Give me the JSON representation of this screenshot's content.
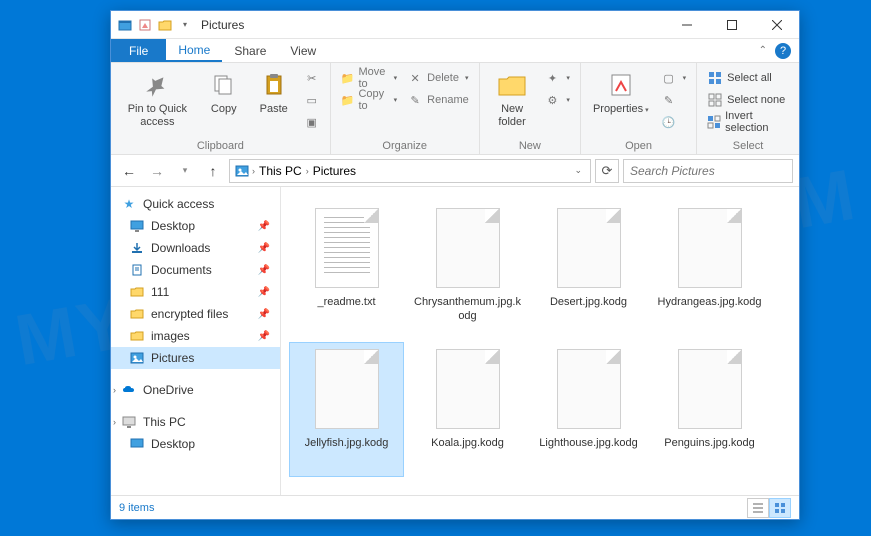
{
  "window": {
    "title": "Pictures"
  },
  "ribbon": {
    "file_tab": "File",
    "tabs": [
      "Home",
      "Share",
      "View"
    ],
    "active_tab": "Home",
    "groups": {
      "clipboard": {
        "label": "Clipboard",
        "pin": "Pin to Quick access",
        "copy": "Copy",
        "paste": "Paste",
        "cut": "Cut",
        "copy_path": "Copy path",
        "paste_shortcut": "Paste shortcut"
      },
      "organize": {
        "label": "Organize",
        "move_to": "Move to",
        "copy_to": "Copy to",
        "delete": "Delete",
        "rename": "Rename"
      },
      "new": {
        "label": "New",
        "new_folder": "New folder",
        "new_item": "New item",
        "easy_access": "Easy access"
      },
      "open": {
        "label": "Open",
        "properties": "Properties",
        "open": "Open",
        "edit": "Edit",
        "history": "History"
      },
      "select": {
        "label": "Select",
        "select_all": "Select all",
        "select_none": "Select none",
        "invert": "Invert selection"
      }
    }
  },
  "breadcrumb": {
    "items": [
      "This PC",
      "Pictures"
    ]
  },
  "search": {
    "placeholder": "Search Pictures"
  },
  "nav": {
    "quick_access": "Quick access",
    "items": [
      {
        "label": "Desktop",
        "icon": "desktop",
        "pinned": true
      },
      {
        "label": "Downloads",
        "icon": "downloads",
        "pinned": true
      },
      {
        "label": "Documents",
        "icon": "documents",
        "pinned": true
      },
      {
        "label": "111",
        "icon": "folder",
        "pinned": true
      },
      {
        "label": "encrypted files",
        "icon": "folder",
        "pinned": true
      },
      {
        "label": "images",
        "icon": "folder",
        "pinned": true
      },
      {
        "label": "Pictures",
        "icon": "pictures",
        "pinned": false,
        "selected": true
      }
    ],
    "onedrive": "OneDrive",
    "this_pc": "This PC",
    "desktop2": "Desktop"
  },
  "files": [
    {
      "name": "_readme.txt",
      "type": "txt"
    },
    {
      "name": "Chrysanthemum.jpg.kodg",
      "type": "blank"
    },
    {
      "name": "Desert.jpg.kodg",
      "type": "blank"
    },
    {
      "name": "Hydrangeas.jpg.kodg",
      "type": "blank"
    },
    {
      "name": "Jellyfish.jpg.kodg",
      "type": "blank",
      "selected": true
    },
    {
      "name": "Koala.jpg.kodg",
      "type": "blank"
    },
    {
      "name": "Lighthouse.jpg.kodg",
      "type": "blank"
    },
    {
      "name": "Penguins.jpg.kodg",
      "type": "blank"
    }
  ],
  "status": {
    "count": "9 items"
  },
  "watermark": "MYANTISPYWARE.COM"
}
